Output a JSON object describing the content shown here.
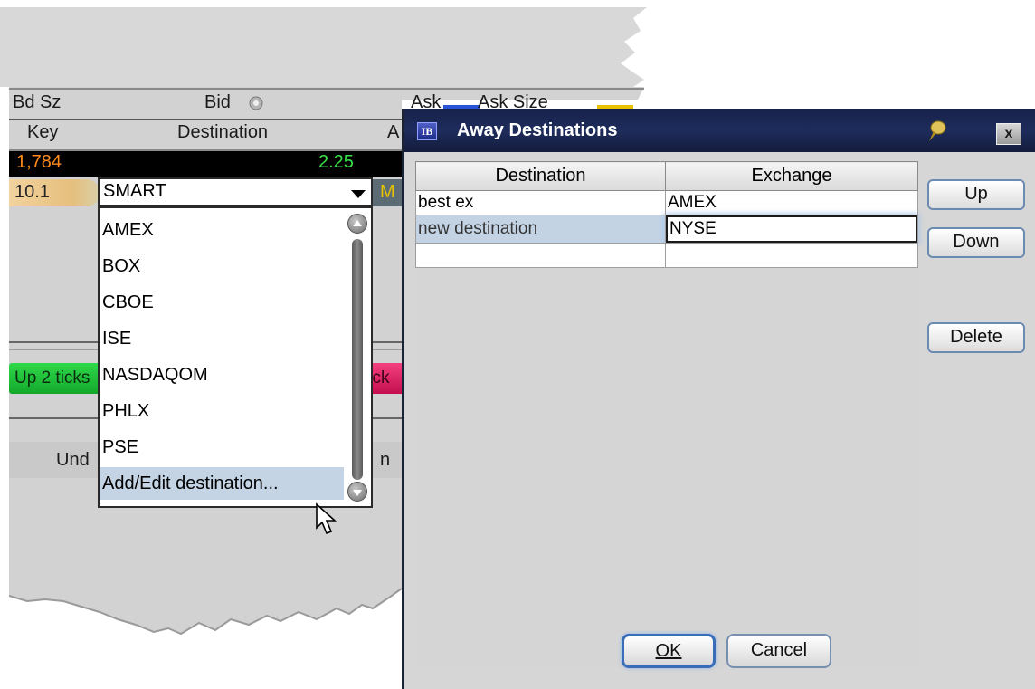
{
  "background_window": {
    "header_row1": {
      "bid_size": "Bd Sz",
      "bid": "Bid",
      "ask": "Ask",
      "ask_size": "Ask Size"
    },
    "header_row2": {
      "key": "Key",
      "destination": "Destination",
      "col3": "A"
    },
    "quote_row": {
      "bid_size": "1,784",
      "bid": "2.25"
    },
    "order_row": {
      "key": "10.1",
      "trailing": "M"
    },
    "buttons": {
      "up_ticks": "Up 2 ticks",
      "down_ticks": "tick"
    },
    "bottom_row": {
      "left": "Und",
      "right": "n"
    }
  },
  "destination_combo": {
    "selected": "SMART",
    "options": [
      "AMEX",
      "BOX",
      "CBOE",
      "ISE",
      "NASDAQOM",
      "PHLX",
      "PSE",
      "Add/Edit destination..."
    ],
    "hovered_index": 7
  },
  "dialog": {
    "title": "Away Destinations",
    "logo": "IB",
    "close_label": "x",
    "columns": [
      "Destination",
      "Exchange"
    ],
    "rows": [
      {
        "destination": "best ex",
        "exchange": "AMEX"
      },
      {
        "destination": "new destination",
        "exchange": "NYSE"
      },
      {
        "destination": "",
        "exchange": ""
      }
    ],
    "selected_row": 1,
    "buttons": {
      "up": "Up",
      "down": "Down",
      "delete": "Delete",
      "ok": "OK",
      "cancel": "Cancel"
    }
  },
  "colors": {
    "titlebar": "#1e2c5c",
    "bid_size": "#ff8a1c",
    "bid": "#39e04a",
    "selection": "#c3d3e4",
    "up_button": "#22c23c",
    "down_button": "#e0236a"
  }
}
